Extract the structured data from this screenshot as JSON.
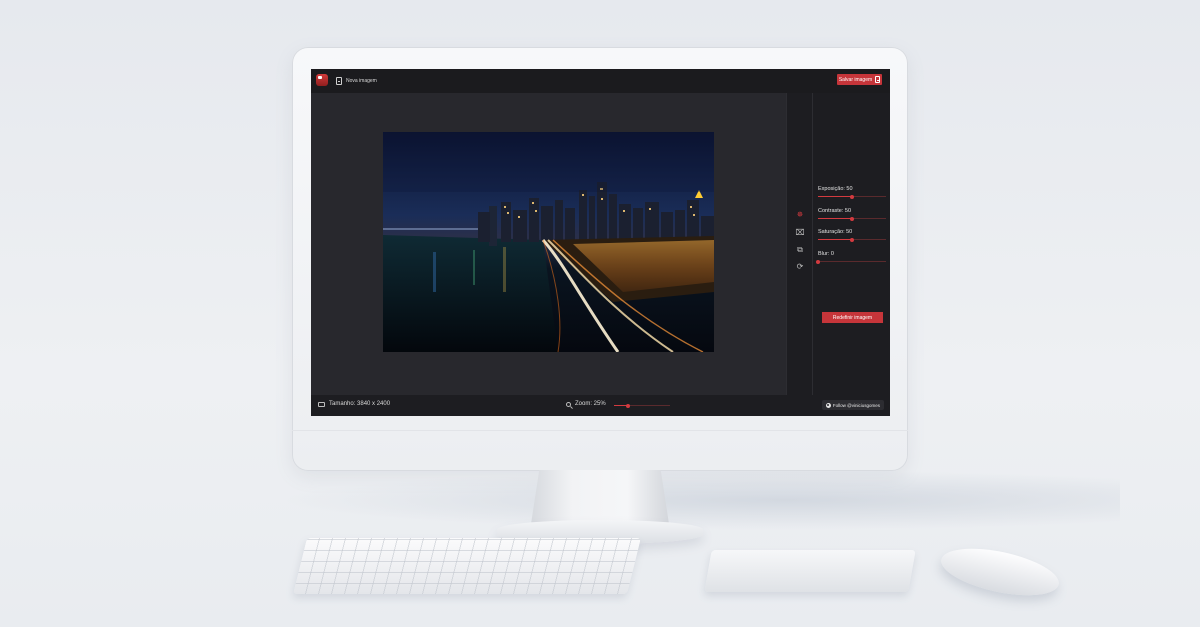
{
  "app": {
    "new_image_label": "Nova imagem",
    "save_label": "Salvar imagem"
  },
  "toolbar": {
    "tools": [
      {
        "name": "adjust-icon",
        "glyph": "✵",
        "active": true
      },
      {
        "name": "fit-icon",
        "glyph": "⌧",
        "active": false
      },
      {
        "name": "crop-icon",
        "glyph": "⧉",
        "active": false
      },
      {
        "name": "rotate-icon",
        "glyph": "⟳",
        "active": false
      }
    ]
  },
  "panel": {
    "adjustments": [
      {
        "label": "Exposição: 50",
        "value": 50,
        "max": 100
      },
      {
        "label": "Contraste: 50",
        "value": 50,
        "max": 100
      },
      {
        "label": "Saturação: 50",
        "value": 50,
        "max": 100
      },
      {
        "label": "Blur: 0",
        "value": 0,
        "max": 100
      }
    ],
    "reset_label": "Redefinir imagem"
  },
  "status": {
    "size_label": "Tamanho: 3840 x 2400",
    "zoom_label": "Zoom: 25%",
    "zoom_value": 25,
    "follow_label": "Follow @viniciusgomes"
  },
  "colors": {
    "accent": "#c6353a",
    "panel_bg": "#1d1d21",
    "canvas_bg": "#28282d"
  }
}
